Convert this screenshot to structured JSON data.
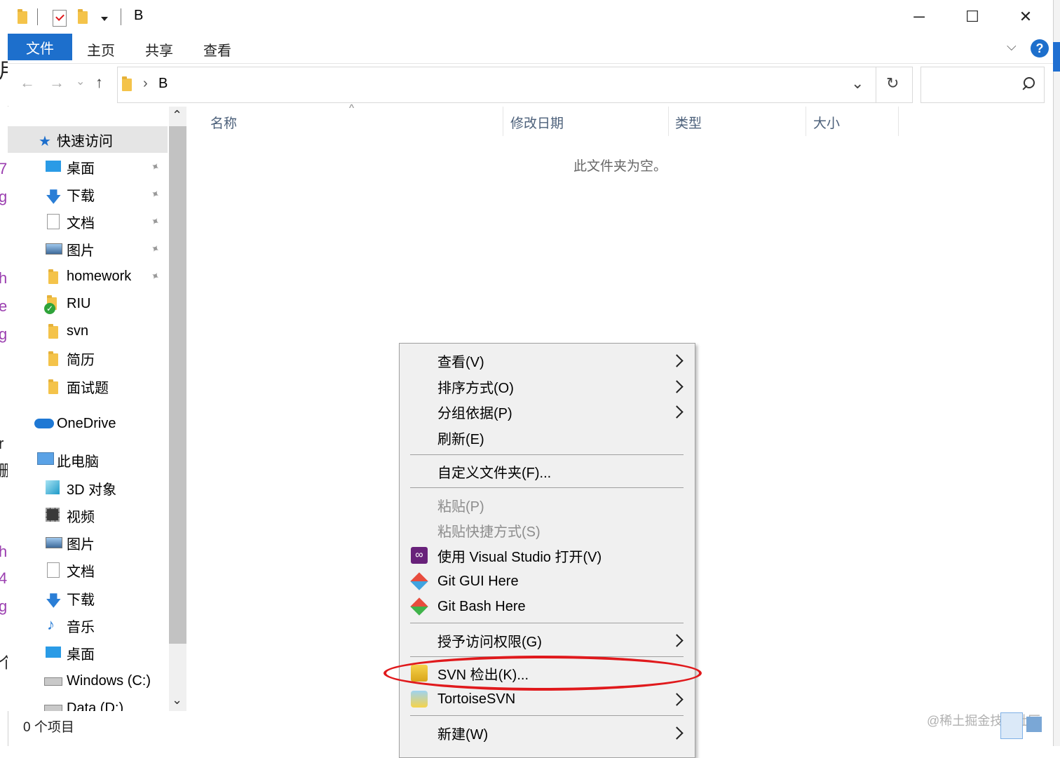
{
  "window": {
    "title": "B",
    "minimize_glyph": "─",
    "maximize_glyph": "☐",
    "close_glyph": "✕"
  },
  "ribbon": {
    "tabs": [
      "文件",
      "主页",
      "共享",
      "查看"
    ],
    "help_glyph": "?",
    "expand_glyph": "⌵"
  },
  "address": {
    "path_item": "B",
    "crumb_chevron": "›",
    "dropdown_glyph": "⌄",
    "refresh_glyph": "↻",
    "search_placeholder": "",
    "back_glyph": "←",
    "forward_glyph": "→",
    "recent_glyph": "⌄",
    "up_glyph": "↑"
  },
  "nav": {
    "quick_access": "快速访问",
    "items": [
      {
        "label": "桌面",
        "icon": "desktop-icon",
        "pinned": true
      },
      {
        "label": "下载",
        "icon": "download-icon",
        "pinned": true
      },
      {
        "label": "文档",
        "icon": "document-icon",
        "pinned": true
      },
      {
        "label": "图片",
        "icon": "picture-icon",
        "pinned": true
      },
      {
        "label": "homework",
        "icon": "folder-icon",
        "pinned": true
      },
      {
        "label": "RIU",
        "icon": "svn-folder-icon",
        "pinned": false
      },
      {
        "label": "svn",
        "icon": "folder-icon",
        "pinned": false
      },
      {
        "label": "简历",
        "icon": "folder-icon",
        "pinned": false
      },
      {
        "label": "面试题",
        "icon": "folder-icon",
        "pinned": false
      }
    ],
    "onedrive": "OneDrive",
    "this_pc": "此电脑",
    "pc_items": [
      {
        "label": "3D 对象",
        "icon": "3d-objects-icon"
      },
      {
        "label": "视频",
        "icon": "video-icon"
      },
      {
        "label": "图片",
        "icon": "picture-icon"
      },
      {
        "label": "文档",
        "icon": "document-icon"
      },
      {
        "label": "下载",
        "icon": "download-icon"
      },
      {
        "label": "音乐",
        "icon": "music-icon"
      },
      {
        "label": "桌面",
        "icon": "desktop-icon"
      },
      {
        "label": "Windows (C:)",
        "icon": "drive-icon"
      },
      {
        "label": "Data (D:)",
        "icon": "drive-icon"
      }
    ],
    "pin_glyph": "📌",
    "scroll_up_glyph": "⌃",
    "scroll_down_glyph": "⌄"
  },
  "columns": {
    "name": "名称",
    "modified": "修改日期",
    "type": "类型",
    "size": "大小",
    "sort_glyph": "^"
  },
  "content": {
    "empty_message": "此文件夹为空。"
  },
  "status": {
    "item_count": "0 个项目"
  },
  "watermark": "@稀土掘金技术社区",
  "context_menu": {
    "items": [
      {
        "label": "查看(V)",
        "submenu": true,
        "disabled": false,
        "icon": ""
      },
      {
        "label": "排序方式(O)",
        "submenu": true,
        "disabled": false,
        "icon": ""
      },
      {
        "label": "分组依据(P)",
        "submenu": true,
        "disabled": false,
        "icon": ""
      },
      {
        "label": "刷新(E)",
        "submenu": false,
        "disabled": false,
        "icon": ""
      },
      {
        "label": "自定义文件夹(F)...",
        "submenu": false,
        "disabled": false,
        "icon": ""
      },
      {
        "label": "粘贴(P)",
        "submenu": false,
        "disabled": true,
        "icon": ""
      },
      {
        "label": "粘贴快捷方式(S)",
        "submenu": false,
        "disabled": true,
        "icon": ""
      },
      {
        "label": "使用 Visual Studio 打开(V)",
        "submenu": false,
        "disabled": false,
        "icon": "visual-studio-icon"
      },
      {
        "label": "Git GUI Here",
        "submenu": false,
        "disabled": false,
        "icon": "git-gui-icon"
      },
      {
        "label": "Git Bash Here",
        "submenu": false,
        "disabled": false,
        "icon": "git-bash-icon"
      },
      {
        "label": "授予访问权限(G)",
        "submenu": true,
        "disabled": false,
        "icon": ""
      },
      {
        "label": "SVN 检出(K)...",
        "submenu": false,
        "disabled": false,
        "icon": "svn-checkout-icon"
      },
      {
        "label": "TortoiseSVN",
        "submenu": true,
        "disabled": false,
        "icon": "tortoisesvn-icon"
      },
      {
        "label": "新建(W)",
        "submenu": true,
        "disabled": false,
        "icon": ""
      }
    ],
    "highlight_color": "#e0191c"
  },
  "background_fragments": [
    "用",
    "7",
    "g",
    "h",
    "e",
    "g",
    "r",
    "删",
    "h",
    "4",
    "g",
    "个"
  ],
  "colors": {
    "accent": "#1d6fcc",
    "menu_bg": "#f0f0f0",
    "folder": "#f4c34a"
  }
}
